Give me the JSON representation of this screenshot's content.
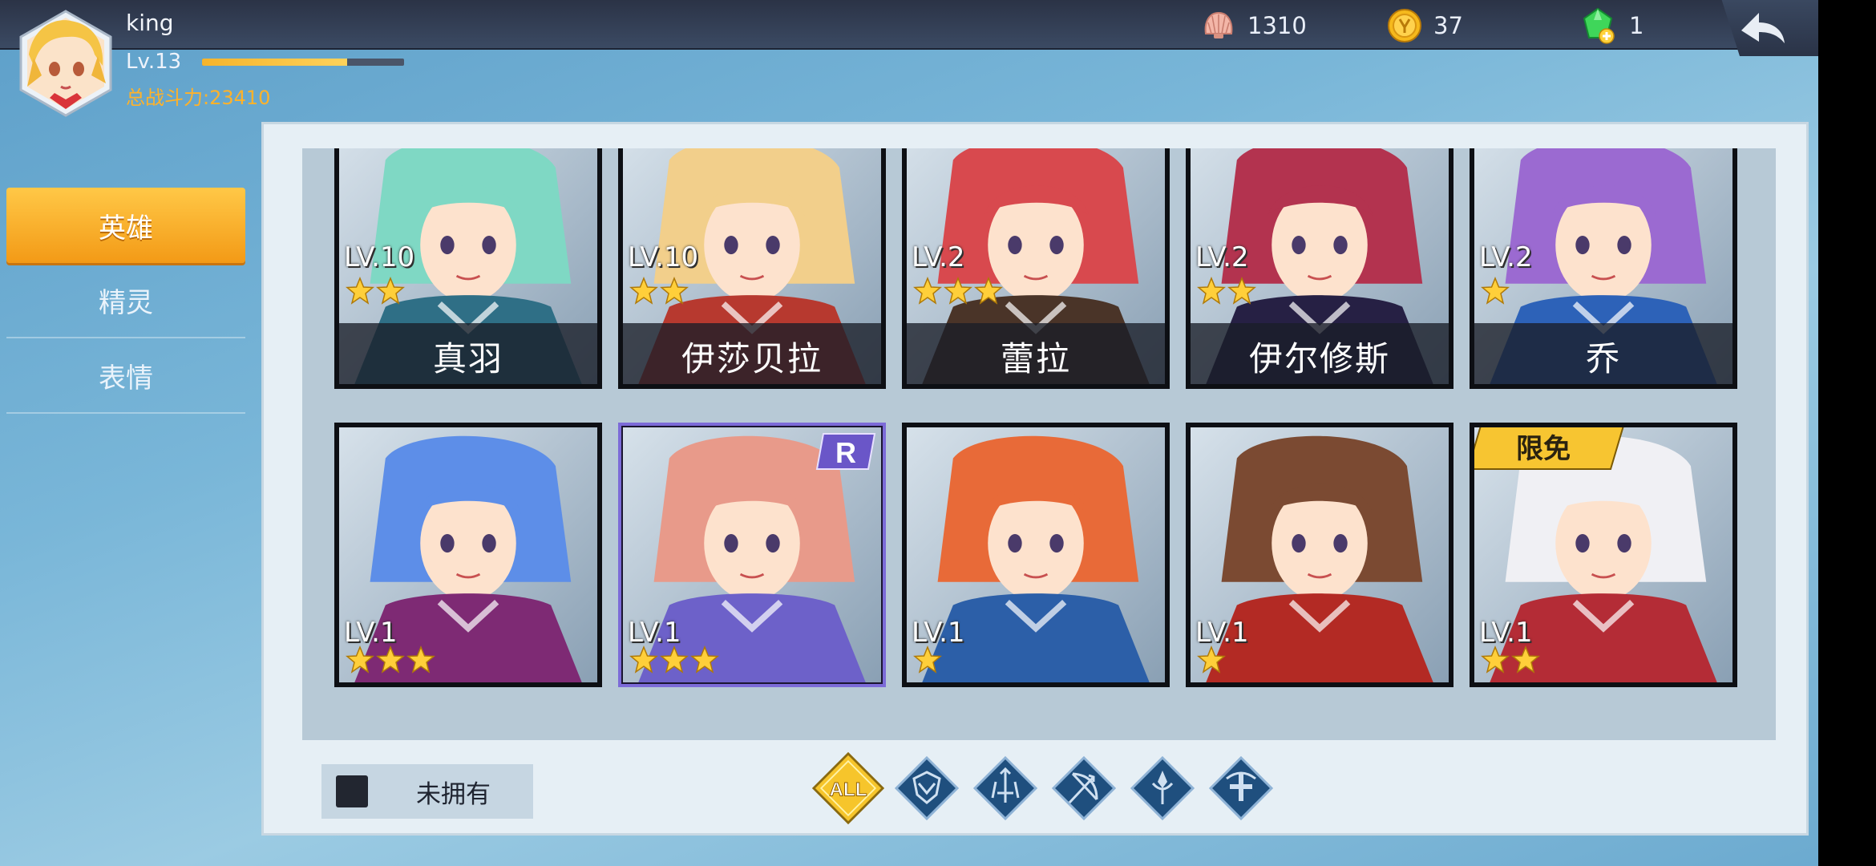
{
  "player": {
    "name": "king",
    "level": "Lv.13",
    "exp_fraction": 0.72,
    "power": "总战斗力:23410"
  },
  "currencies": [
    {
      "icon": "shell-icon",
      "value": "1310"
    },
    {
      "icon": "gold-coin-icon",
      "value": "37"
    },
    {
      "icon": "green-gem-plus-icon",
      "value": "1"
    }
  ],
  "menu": {
    "items": [
      {
        "label": "英雄",
        "active": true
      },
      {
        "label": "精灵",
        "active": false
      },
      {
        "label": "表情",
        "active": false
      }
    ]
  },
  "heroes": [
    {
      "name": "真羽",
      "level": "LV.10",
      "stars": 2,
      "palette": [
        "#7fd8c4",
        "#2f6f86"
      ]
    },
    {
      "name": "伊莎贝拉",
      "level": "LV.10",
      "stars": 2,
      "palette": [
        "#f2cf8b",
        "#b7392f"
      ]
    },
    {
      "name": "蕾拉",
      "level": "LV.2",
      "stars": 3,
      "palette": [
        "#d8494e",
        "#4a3428"
      ]
    },
    {
      "name": "伊尔修斯",
      "level": "LV.2",
      "stars": 2,
      "palette": [
        "#b3334f",
        "#262044"
      ]
    },
    {
      "name": "乔",
      "level": "LV.2",
      "stars": 1,
      "palette": [
        "#9b6ad1",
        "#2d62b8"
      ]
    },
    {
      "name": "",
      "level": "LV.1",
      "stars": 3,
      "palette": [
        "#5d8ee8",
        "#7e2a74"
      ]
    },
    {
      "name": "",
      "level": "LV.1",
      "stars": 3,
      "palette": [
        "#e89a8a",
        "#6d61c9"
      ],
      "badge": "R"
    },
    {
      "name": "",
      "level": "LV.1",
      "stars": 1,
      "palette": [
        "#e86a38",
        "#2c5fa8"
      ]
    },
    {
      "name": "",
      "level": "LV.1",
      "stars": 1,
      "palette": [
        "#7b4a32",
        "#b32a24"
      ]
    },
    {
      "name": "",
      "level": "LV.1",
      "stars": 2,
      "palette": [
        "#f0f0f4",
        "#b42c36"
      ],
      "badge": "限免"
    }
  ],
  "filters": {
    "owned_label": "未拥有",
    "all_label": "ALL",
    "class_icons": [
      "shield-class-icon",
      "sword-class-icon",
      "bow-class-icon",
      "magic-class-icon",
      "healer-class-icon"
    ]
  },
  "colors": {
    "accent_orange": "#f5a623",
    "star_gold": "#ffcf3a",
    "all_gold": "#f6c52b"
  }
}
